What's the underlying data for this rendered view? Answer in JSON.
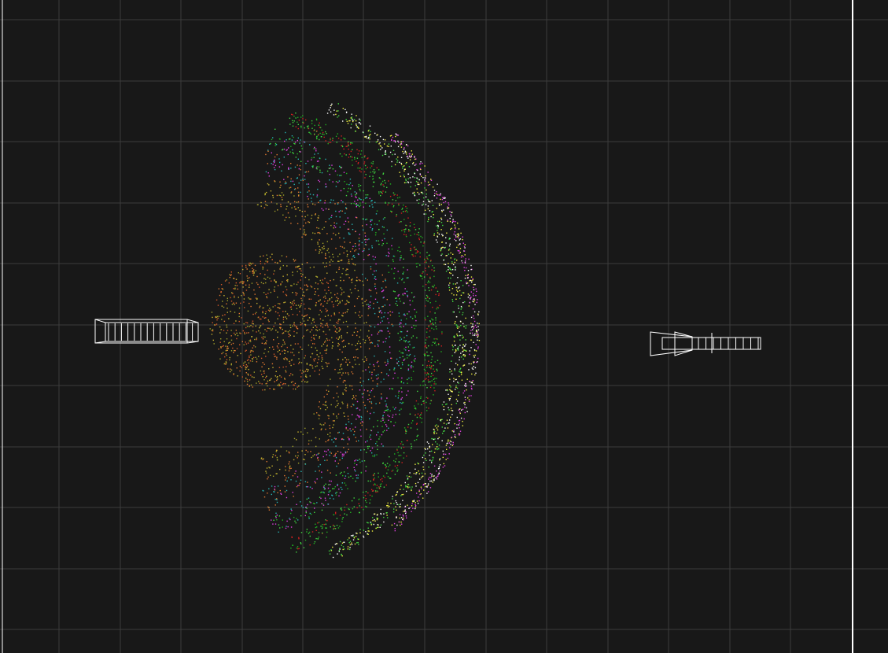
{
  "viewport": {
    "background": "#181818",
    "grid_color": "#3c3c3c",
    "frame_color": "#ffffff"
  },
  "point_cloud": {
    "palette": [
      "#c8b030",
      "#a0a028",
      "#e07830",
      "#d05828",
      "#40d840",
      "#20b020",
      "#28b4b4",
      "#e040e0",
      "#f0f040",
      "#ffffff",
      "#d02020"
    ],
    "color_names": [
      "olive-yellow",
      "olive",
      "orange",
      "dark-orange",
      "green",
      "dark-green",
      "cyan",
      "magenta",
      "yellow",
      "white",
      "red"
    ]
  },
  "objects": [
    {
      "name": "camera-frustum-left",
      "icon": "camera-frustum-icon",
      "color": "#ffffff"
    },
    {
      "name": "camera-frustum-right",
      "icon": "camera-frustum-icon",
      "color": "#ffffff"
    }
  ]
}
